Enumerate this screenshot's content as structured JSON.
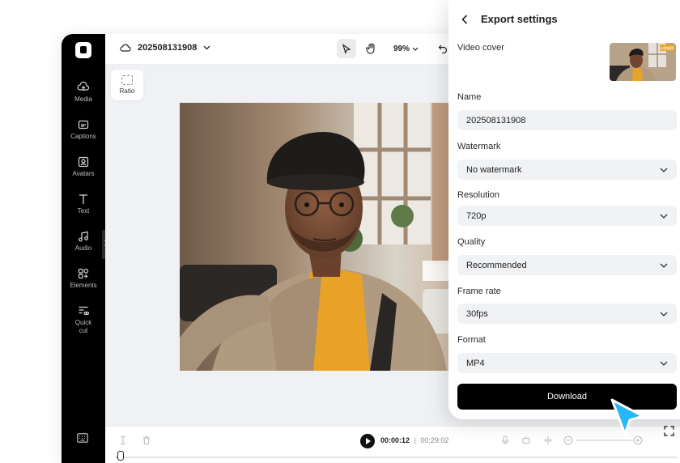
{
  "project": {
    "name": "202508131908"
  },
  "toolbar": {
    "zoom": "99%"
  },
  "sidebar": {
    "items": [
      {
        "label": "Media",
        "icon": "media-icon"
      },
      {
        "label": "Captions",
        "icon": "captions-icon"
      },
      {
        "label": "Avatars",
        "icon": "avatars-icon"
      },
      {
        "label": "Text",
        "icon": "text-icon"
      },
      {
        "label": "Audio",
        "icon": "audio-icon"
      },
      {
        "label": "Elements",
        "icon": "elements-icon"
      },
      {
        "label": "Quick\ncut",
        "icon": "quick-cut-icon"
      }
    ]
  },
  "canvas": {
    "ratio_label": "Ratio"
  },
  "timeline": {
    "current_time": "00:00:12",
    "separator": "|",
    "total_time": "00:29:02"
  },
  "export": {
    "title": "Export settings",
    "video_cover_label": "Video cover",
    "cover_badge": "LOGO",
    "name_label": "Name",
    "name_value": "202508131908",
    "watermark_label": "Watermark",
    "watermark_value": "No watermark",
    "resolution_label": "Resolution",
    "resolution_value": "720p",
    "quality_label": "Quality",
    "quality_value": "Recommended",
    "framerate_label": "Frame rate",
    "framerate_value": "30fps",
    "format_label": "Format",
    "format_value": "MP4",
    "download_label": "Download"
  },
  "colors": {
    "accent": "#2f7bf6",
    "cursor": "#28b6f6",
    "primary_button": "#000000"
  }
}
